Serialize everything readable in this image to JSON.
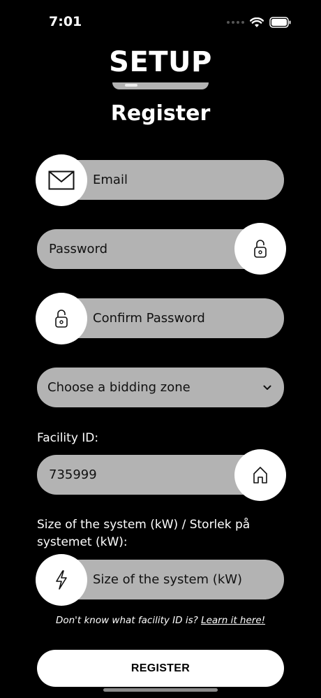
{
  "status": {
    "time": "7:01"
  },
  "app_title": "SETUP",
  "page_title": "Register",
  "form": {
    "email_placeholder": "Email",
    "password_placeholder": "Password",
    "confirm_password_placeholder": "Confirm Password",
    "bidding_zone_label": "Choose a bidding zone",
    "facility_id_label": "Facility ID:",
    "facility_id_value": "735999",
    "system_size_label_line1": "Size of the system (kW) / Storlek på",
    "system_size_label_line2": "systemet (kW):",
    "system_size_placeholder": "Size of the system (kW)"
  },
  "help": {
    "text": "Don't know what facility ID is?",
    "link": "Learn it here!"
  },
  "register_button": "REGISTER",
  "icons": [
    "mail-icon",
    "lock-icon",
    "lock-icon",
    "chevron-down-icon",
    "home-icon",
    "lightning-icon"
  ],
  "colors": {
    "background": "#000000",
    "field": "#b3b3b3",
    "button": "#ffffff"
  }
}
